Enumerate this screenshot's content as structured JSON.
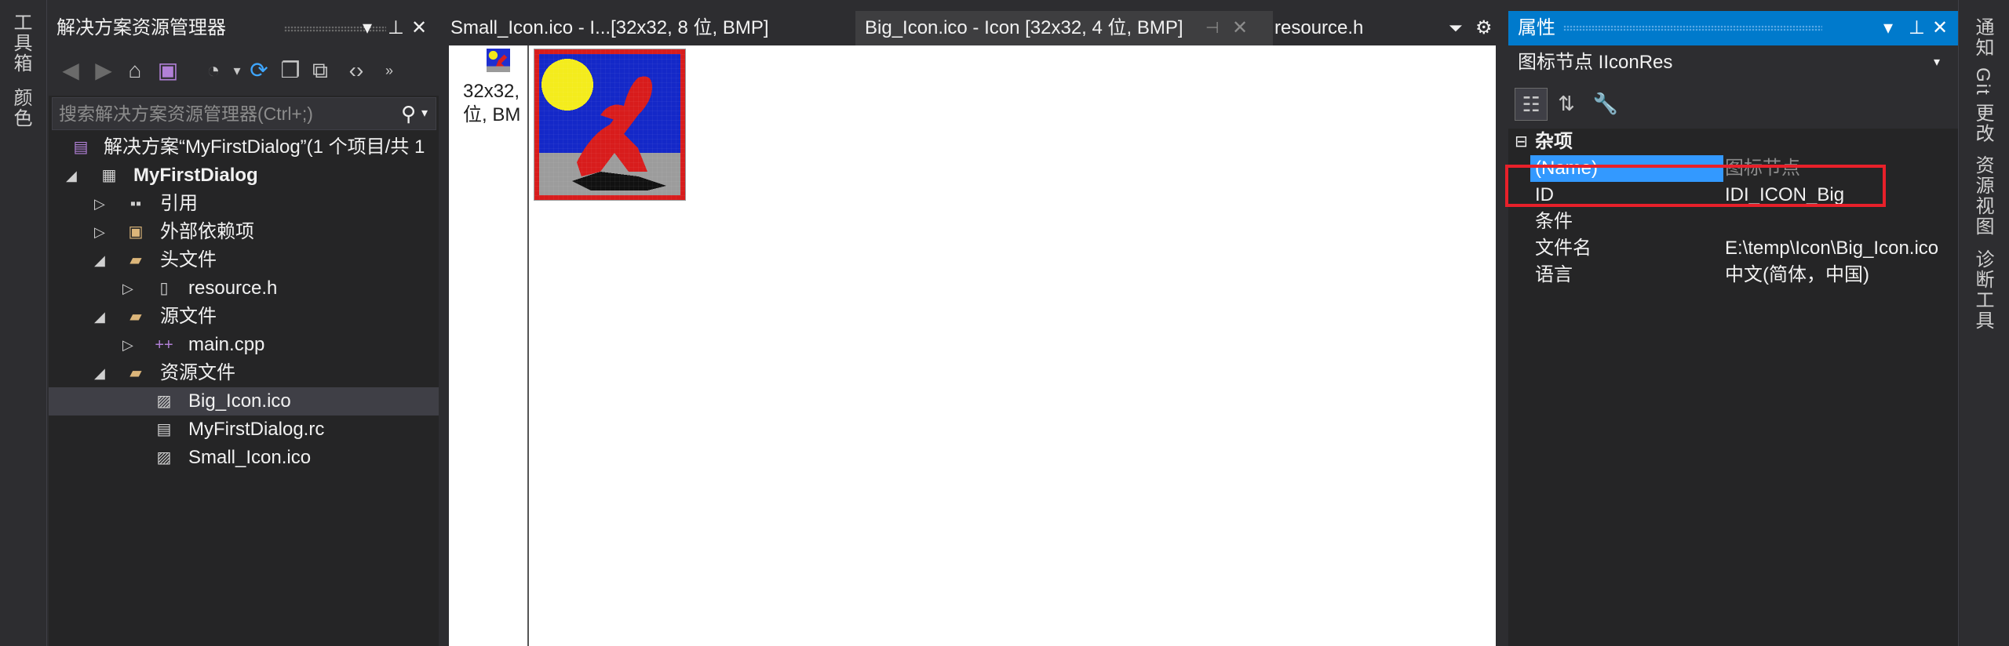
{
  "left_strip": {
    "tabs": [
      "工具箱",
      "颜色"
    ]
  },
  "right_strip": {
    "tabs": [
      "通知",
      "Git 更改",
      "资源视图",
      "诊断工具"
    ]
  },
  "solution_explorer": {
    "title": "解决方案资源管理器",
    "search_placeholder": "搜索解决方案资源管理器(Ctrl+;)",
    "tree": [
      {
        "label": "解决方案“MyFirstDialog”(1 个项目/共 1",
        "icon": "solution-icon"
      },
      {
        "label": "MyFirstDialog",
        "icon": "project-icon"
      },
      {
        "label": "引用",
        "icon": "references-icon"
      },
      {
        "label": "外部依赖项",
        "icon": "external-deps-icon"
      },
      {
        "label": "头文件",
        "icon": "folder-icon"
      },
      {
        "label": "resource.h",
        "icon": "header-file-icon"
      },
      {
        "label": "源文件",
        "icon": "folder-icon"
      },
      {
        "label": "main.cpp",
        "icon": "cpp-file-icon"
      },
      {
        "label": "资源文件",
        "icon": "folder-icon"
      },
      {
        "label": "Big_Icon.ico",
        "icon": "image-file-icon"
      },
      {
        "label": "MyFirstDialog.rc",
        "icon": "rc-file-icon"
      },
      {
        "label": "Small_Icon.ico",
        "icon": "image-file-icon"
      }
    ]
  },
  "document_tabs": {
    "tab1": "Small_Icon.ico - I...[32x32, 8 位, BMP]",
    "tab2": "Big_Icon.ico - Icon [32x32, 4 位, BMP]",
    "tab3": "resource.h"
  },
  "icon_editor": {
    "thumb_caption_line1": "32x32,",
    "thumb_caption_line2": "位, BM"
  },
  "properties": {
    "title": "属性",
    "object": "图标节点  IIconRes",
    "category": "杂项",
    "rows": [
      {
        "name": "(Name)",
        "value": "图标节点"
      },
      {
        "name": "ID",
        "value": "IDI_ICON_Big"
      },
      {
        "name": "条件",
        "value": ""
      },
      {
        "name": "文件名",
        "value": "E:\\temp\\Icon\\Big_Icon.ico"
      },
      {
        "name": "语言",
        "value": "中文(简体，中国)"
      }
    ]
  },
  "colors": {
    "accent": "#007acc",
    "highlight_box": "#e8202a",
    "selection": "#3f3f46"
  }
}
